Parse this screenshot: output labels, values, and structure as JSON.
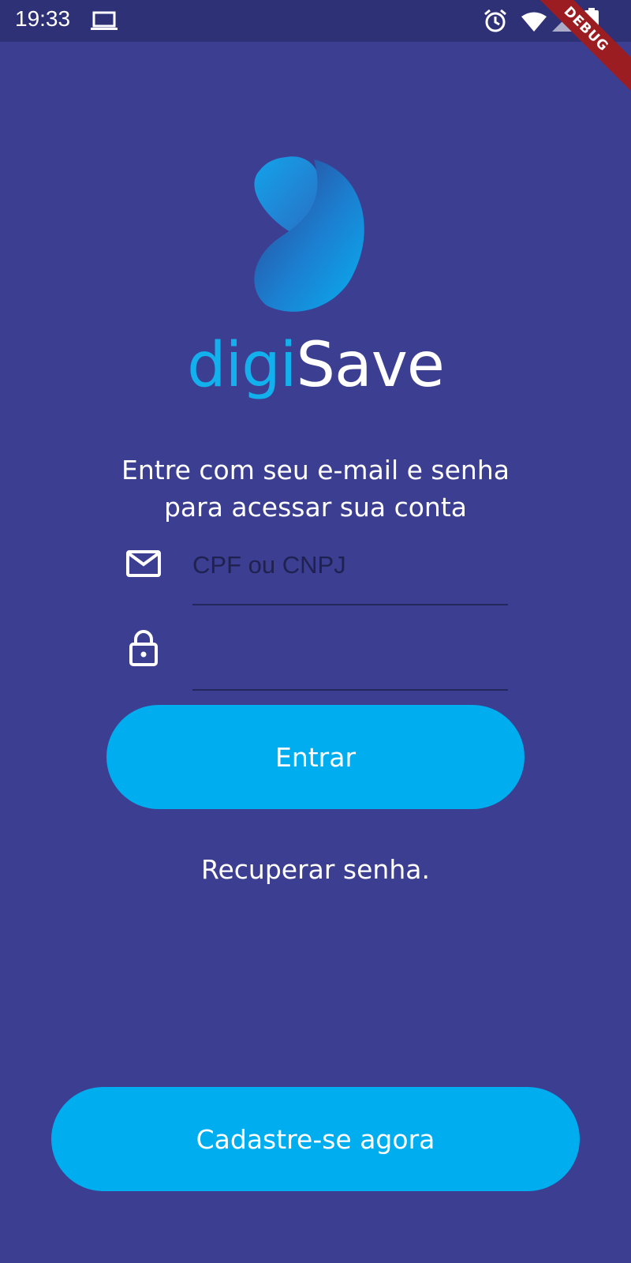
{
  "status_bar": {
    "time": "19:33",
    "icons": [
      "laptop-icon",
      "alarm-icon",
      "wifi-icon",
      "signal-icon",
      "battery-icon"
    ],
    "debug_banner": "DEBUG"
  },
  "logo": {
    "text_part1": "digi",
    "text_part2": "Save"
  },
  "intro": {
    "line1": "Entre com seu e-mail e senha",
    "line2": "para acessar sua conta"
  },
  "login_form": {
    "username_placeholder": "CPF ou CNPJ",
    "username_icon": "mail-icon",
    "password_placeholder": "",
    "password_icon": "lock-icon",
    "submit_label": "Entrar"
  },
  "recover_link": "Recuperar senha.",
  "signup_button": "Cadastre-se agora",
  "colors": {
    "background": "#3c3f91",
    "status_bar": "#2f3177",
    "accent": "#00adef",
    "debug_banner": "#9b1d22"
  }
}
